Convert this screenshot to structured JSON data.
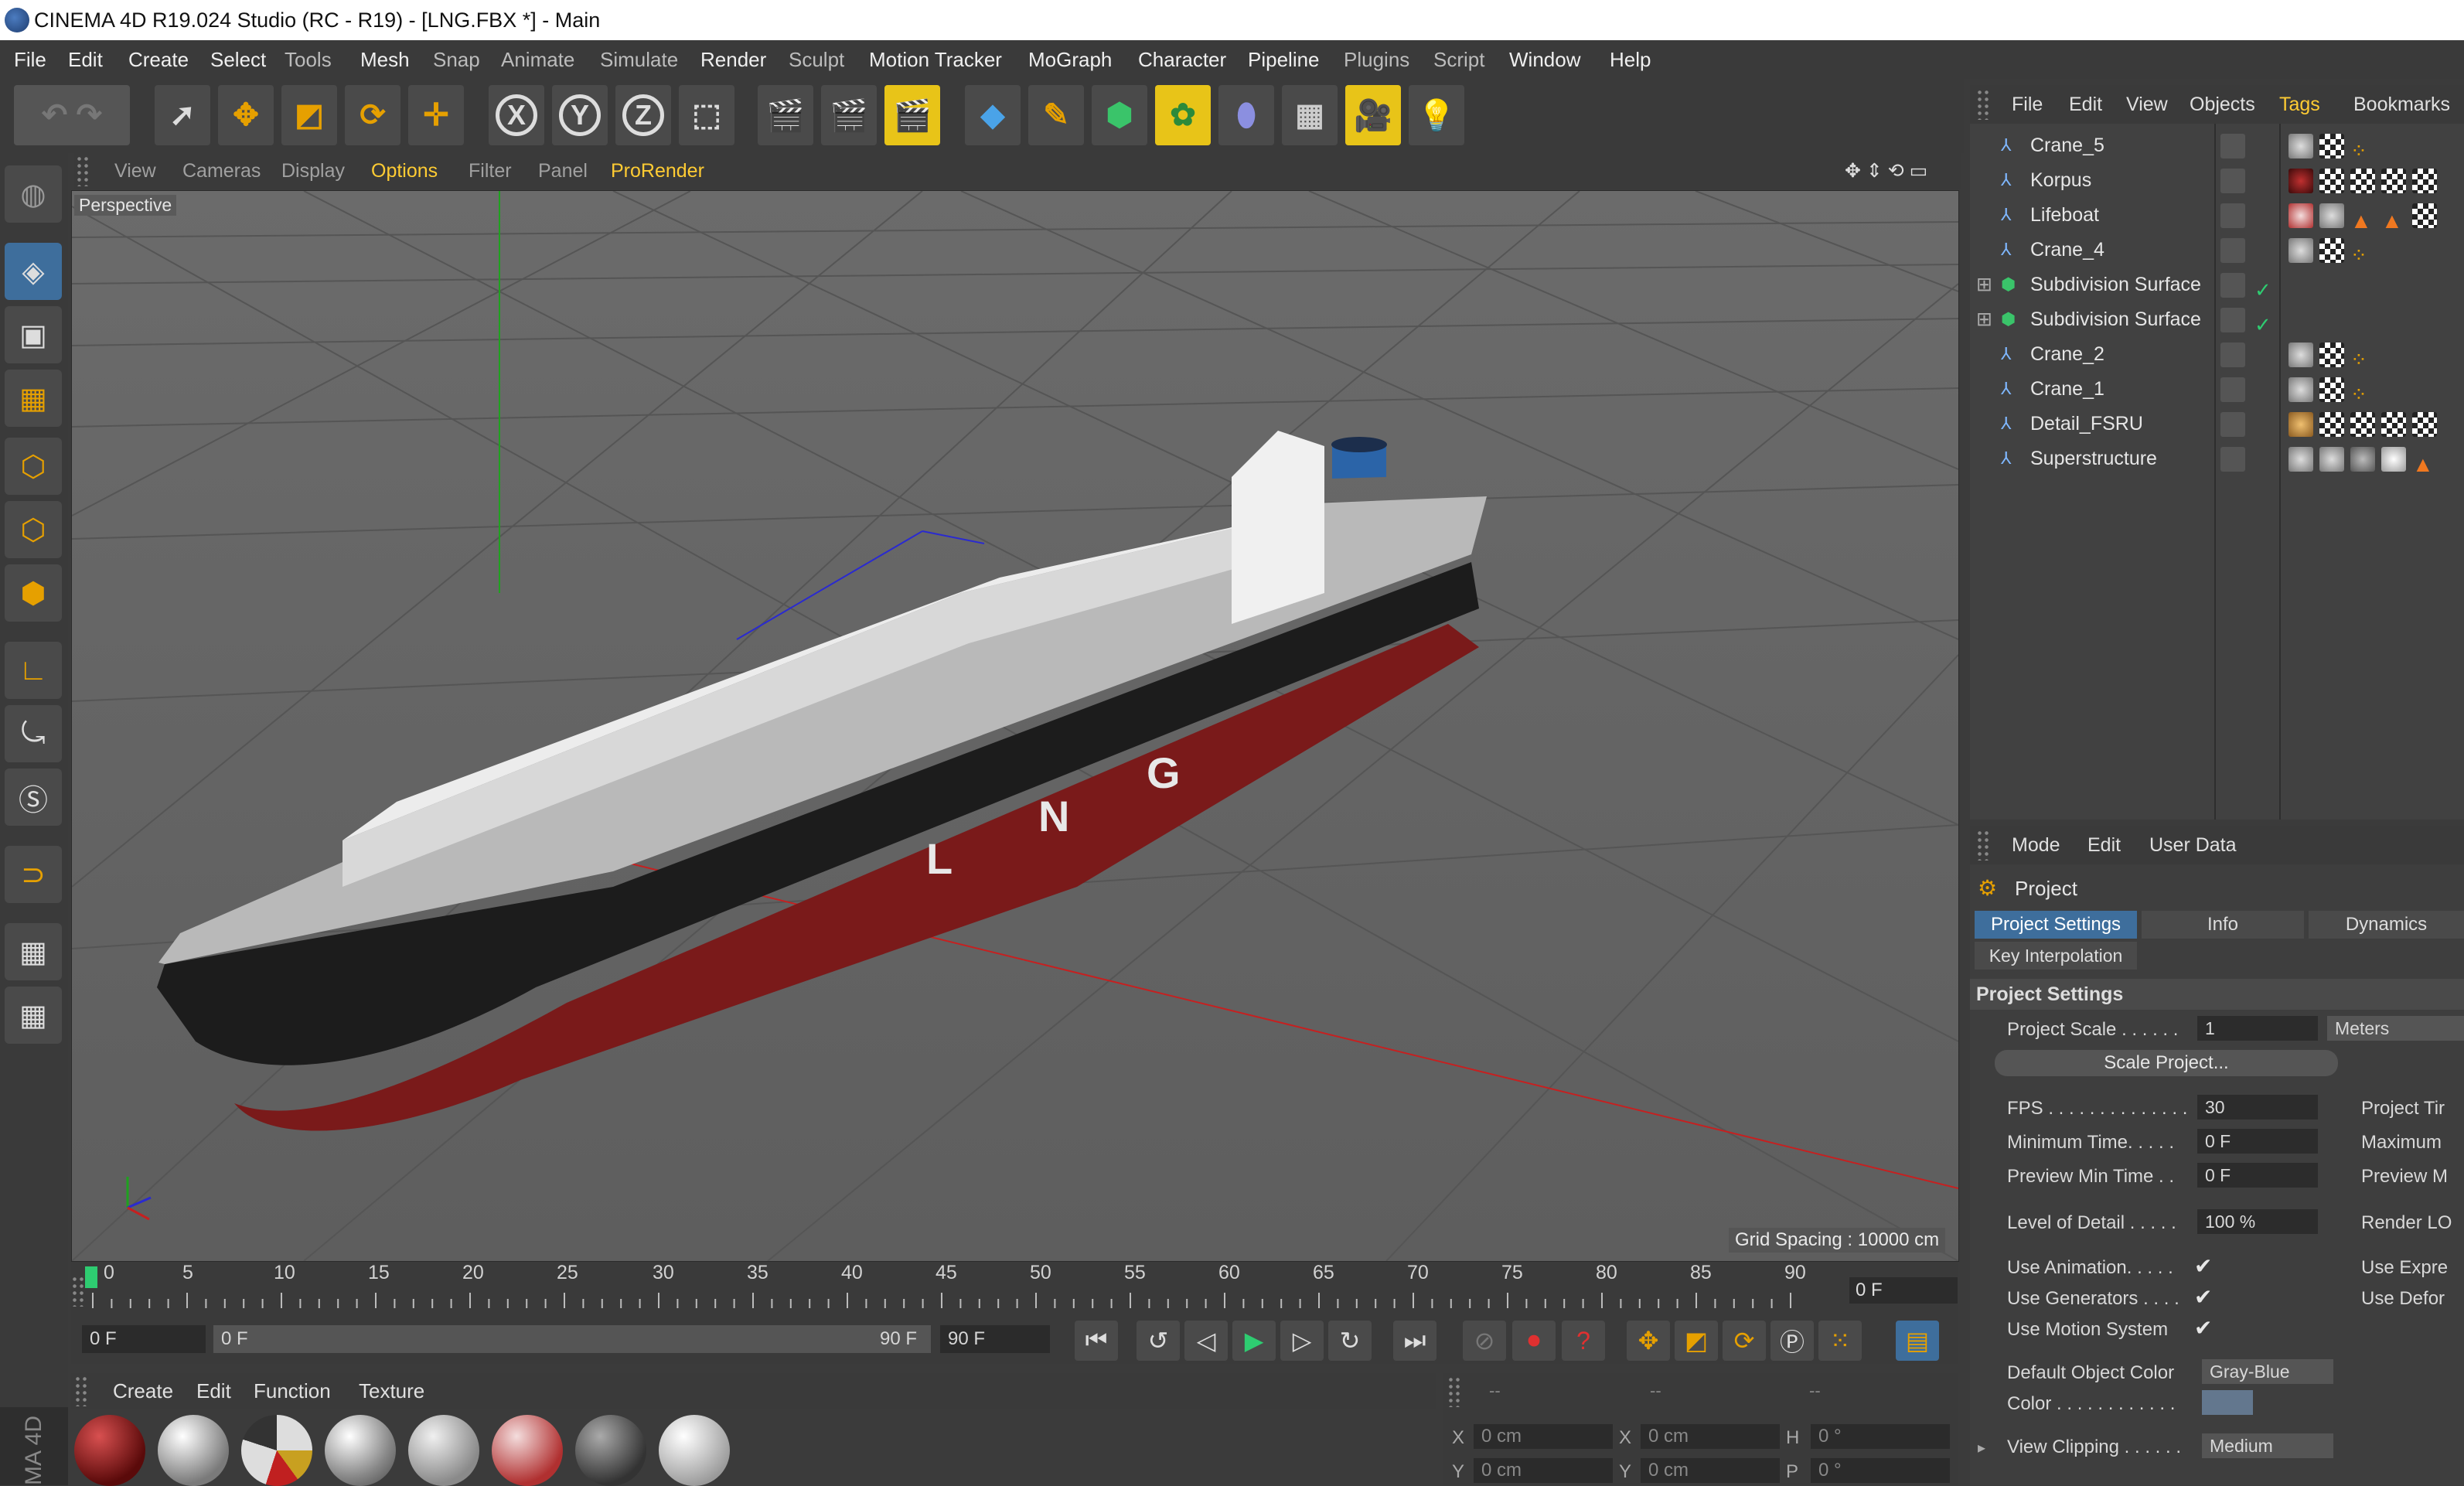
{
  "window": {
    "title": "CINEMA 4D R19.024 Studio (RC - R19) - [LNG.FBX *] - Main"
  },
  "menubar": [
    "File",
    "Edit",
    "Create",
    "Select",
    "Tools",
    "Mesh",
    "Snap",
    "Animate",
    "Simulate",
    "Render",
    "Sculpt",
    "Motion Tracker",
    "MoGraph",
    "Character",
    "Pipeline",
    "Plugins",
    "Script",
    "Window",
    "Help"
  ],
  "viewport": {
    "menu": [
      "View",
      "Cameras",
      "Display",
      "Options",
      "Filter",
      "Panel",
      "ProRender"
    ],
    "active_menu": "Options",
    "camera_label": "Perspective",
    "grid_spacing": "Grid Spacing : 10000 cm",
    "hull_letters": [
      "L",
      "N",
      "G"
    ]
  },
  "timeline": {
    "ticks": [
      "0",
      "5",
      "10",
      "15",
      "20",
      "25",
      "30",
      "35",
      "40",
      "45",
      "50",
      "55",
      "60",
      "65",
      "70",
      "75",
      "80",
      "85",
      "90"
    ],
    "current_frame": "0 F",
    "start_frame": "0 F",
    "range_start": "0 F",
    "range_end": "90 F",
    "end_frame": "90 F"
  },
  "material_manager": {
    "menu": [
      "Create",
      "Edit",
      "Function",
      "Texture"
    ],
    "side_logo": "MA 4D"
  },
  "coordinates": {
    "header": [
      "--",
      "--",
      "--"
    ],
    "rows": [
      {
        "a": "X",
        "av": "0 cm",
        "b": "X",
        "bv": "0 cm",
        "c": "H",
        "cv": "0 °"
      },
      {
        "a": "Y",
        "av": "0 cm",
        "b": "Y",
        "bv": "0 cm",
        "c": "P",
        "cv": "0 °"
      }
    ]
  },
  "object_manager": {
    "menu": [
      "File",
      "Edit",
      "View",
      "Objects",
      "Tags",
      "Bookmarks"
    ],
    "active_menu": "Tags",
    "objects": [
      {
        "name": "Crane_5",
        "type": "null"
      },
      {
        "name": "Korpus",
        "type": "null"
      },
      {
        "name": "Lifeboat",
        "type": "null"
      },
      {
        "name": "Crane_4",
        "type": "null"
      },
      {
        "name": "Subdivision Surface",
        "type": "subdivision"
      },
      {
        "name": "Subdivision Surface",
        "type": "subdivision"
      },
      {
        "name": "Crane_2",
        "type": "null"
      },
      {
        "name": "Crane_1",
        "type": "null"
      },
      {
        "name": "Detail_FSRU",
        "type": "null"
      },
      {
        "name": "Superstructure",
        "type": "null"
      }
    ]
  },
  "attribute_manager": {
    "menu": [
      "Mode",
      "Edit",
      "User Data"
    ],
    "object": "Project",
    "tabs": [
      "Project Settings",
      "Info",
      "Dynamics"
    ],
    "tab2": "Key Interpolation",
    "section": "Project Settings",
    "project_scale_label": "Project Scale . . . . . .",
    "project_scale_value": "1",
    "project_scale_unit": "Meters",
    "scale_button": "Scale Project...",
    "fps_label": "FPS . . . . . . . . . . . . . .",
    "fps_value": "30",
    "min_time_label": "Minimum Time. . . . .",
    "min_time_value": "0 F",
    "preview_min_label": "Preview Min Time . .",
    "preview_min_value": "0 F",
    "lod_label": "Level of Detail . . . . .",
    "lod_value": "100 %",
    "right_col": [
      "Project Tir",
      "Maximum",
      "Preview M",
      "Render LO",
      "Use Expre",
      "Use Defor"
    ],
    "use_animation": "Use Animation. . . . .",
    "use_generators": "Use Generators . . . .",
    "use_motion": "Use Motion System",
    "default_color_label": "Default Object Color",
    "default_color_value": "Gray-Blue",
    "color_label": "Color . . . . . . . . . . . .",
    "view_clipping_label": "View Clipping . . . . . .",
    "view_clipping_value": "Medium"
  },
  "colors": {
    "accent": "#ffcc33",
    "selected_tab": "#3e6e9c",
    "hull_black": "#1c1c1c",
    "hull_red": "#7a1a1a"
  }
}
